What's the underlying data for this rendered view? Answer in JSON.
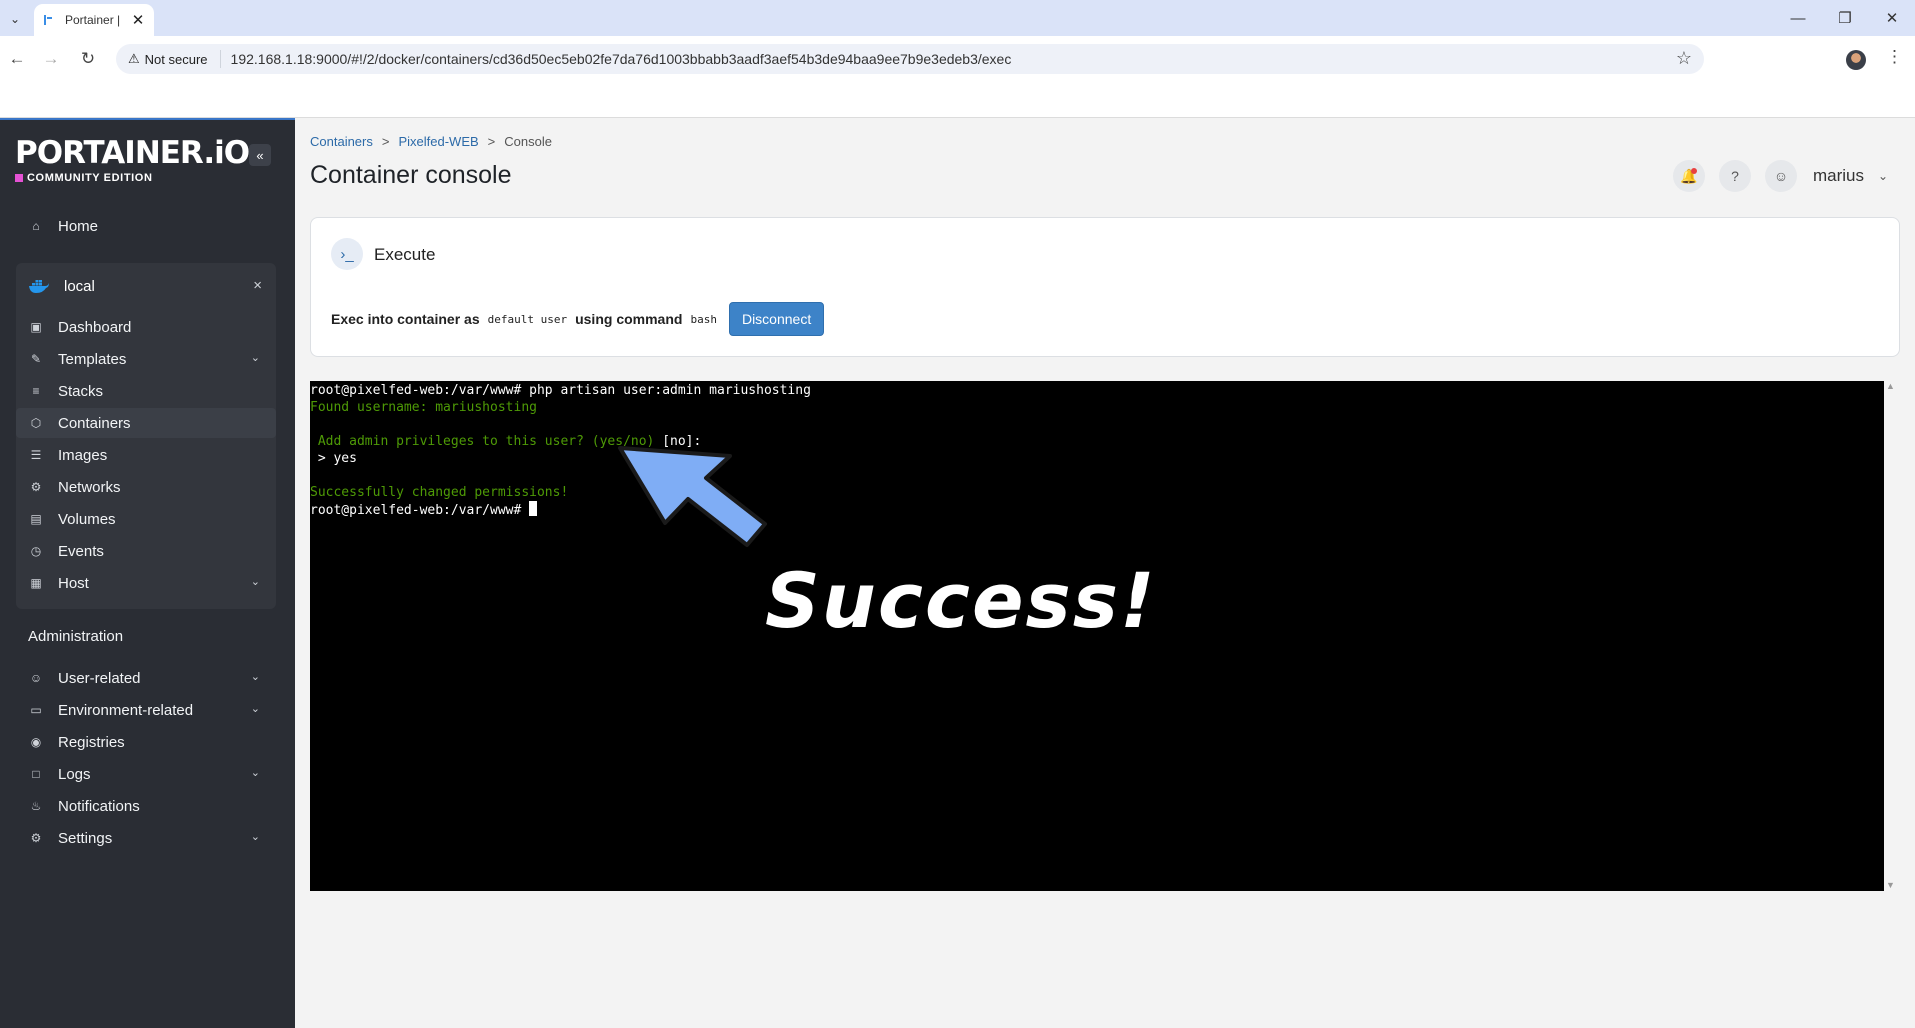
{
  "browser": {
    "tab_title": "Portainer |",
    "not_secure": "Not secure",
    "url": "192.168.1.18:9000/#!/2/docker/containers/cd36d50ec5eb02fe7da76d1003bbabb3aadf3aef54b3de94baa9ee7b9e3edeb3/exec"
  },
  "logo": {
    "name": "PORTAINER.iO",
    "edition": "COMMUNITY EDITION"
  },
  "sidebar": {
    "home": "Home",
    "environment": "local",
    "env_items": [
      "Dashboard",
      "Templates",
      "Stacks",
      "Containers",
      "Images",
      "Networks",
      "Volumes",
      "Events",
      "Host"
    ],
    "admin_title": "Administration",
    "admin_items": [
      "User-related",
      "Environment-related",
      "Registries",
      "Logs",
      "Notifications",
      "Settings"
    ]
  },
  "breadcrumb": [
    "Containers",
    ">",
    "Pixelfed-WEB",
    ">",
    "Console"
  ],
  "page_title": "Container console",
  "user": {
    "name": "marius"
  },
  "execute": {
    "title": "Execute",
    "line_prefix": "Exec into container as",
    "user_value": "default user",
    "line_middle": "using command",
    "command_value": "bash",
    "disconnect_label": "Disconnect"
  },
  "terminal": {
    "line1": "root@pixelfed-web:/var/www# php artisan user:admin mariushosting",
    "line2": "Found username: mariushosting",
    "line3_green": " Add admin privileges to this user? (yes/no)",
    "line3_white": " [no]:",
    "line4": " > yes",
    "line5": "Successfully changed permissions!",
    "line6": "root@pixelfed-web:/var/www# "
  },
  "annotation": {
    "text": "Success!",
    "arrow_color": "#7fadf5"
  },
  "colors": {
    "sidebar_bg": "#2a2d34",
    "accent": "#3d83c8",
    "terminal_green": "#4e9a06"
  }
}
